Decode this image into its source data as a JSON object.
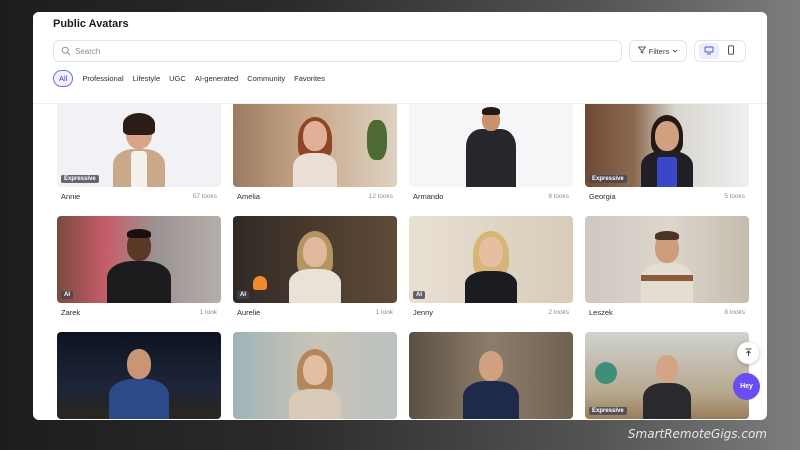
{
  "header": {
    "title": "Public Avatars",
    "search_placeholder": "Search",
    "filters_label": "Filters"
  },
  "chips": [
    "All",
    "Professional",
    "Lifestyle",
    "UGC",
    "AI-generated",
    "Community",
    "Favorites"
  ],
  "active_chip": "All",
  "avatars": [
    {
      "name": "Annie",
      "looks": "57 looks",
      "badge": "Expressive"
    },
    {
      "name": "Amelia",
      "looks": "12 looks",
      "badge": ""
    },
    {
      "name": "Armando",
      "looks": "8 looks",
      "badge": ""
    },
    {
      "name": "Georgia",
      "looks": "5 looks",
      "badge": "Expressive"
    },
    {
      "name": "Zarek",
      "looks": "1 look",
      "badge": "AI"
    },
    {
      "name": "Aurelie",
      "looks": "1 look",
      "badge": "AI"
    },
    {
      "name": "Jenny",
      "looks": "2 looks",
      "badge": "AI"
    },
    {
      "name": "Leszek",
      "looks": "8 looks",
      "badge": ""
    },
    {
      "name": "",
      "looks": "",
      "badge": ""
    },
    {
      "name": "",
      "looks": "",
      "badge": ""
    },
    {
      "name": "",
      "looks": "",
      "badge": ""
    },
    {
      "name": "",
      "looks": "",
      "badge": "Expressive"
    }
  ],
  "chat_button": "Hey",
  "watermark": "SmartRemoteGigs.com",
  "colors": {
    "accent": "#6a4df4",
    "chip_active_border": "#6a6ef5"
  },
  "icons": {
    "search": "search-icon",
    "filter": "filter-icon",
    "desktop": "desktop-view-icon",
    "mobile": "mobile-view-icon",
    "scroll_top": "arrow-up-icon"
  }
}
